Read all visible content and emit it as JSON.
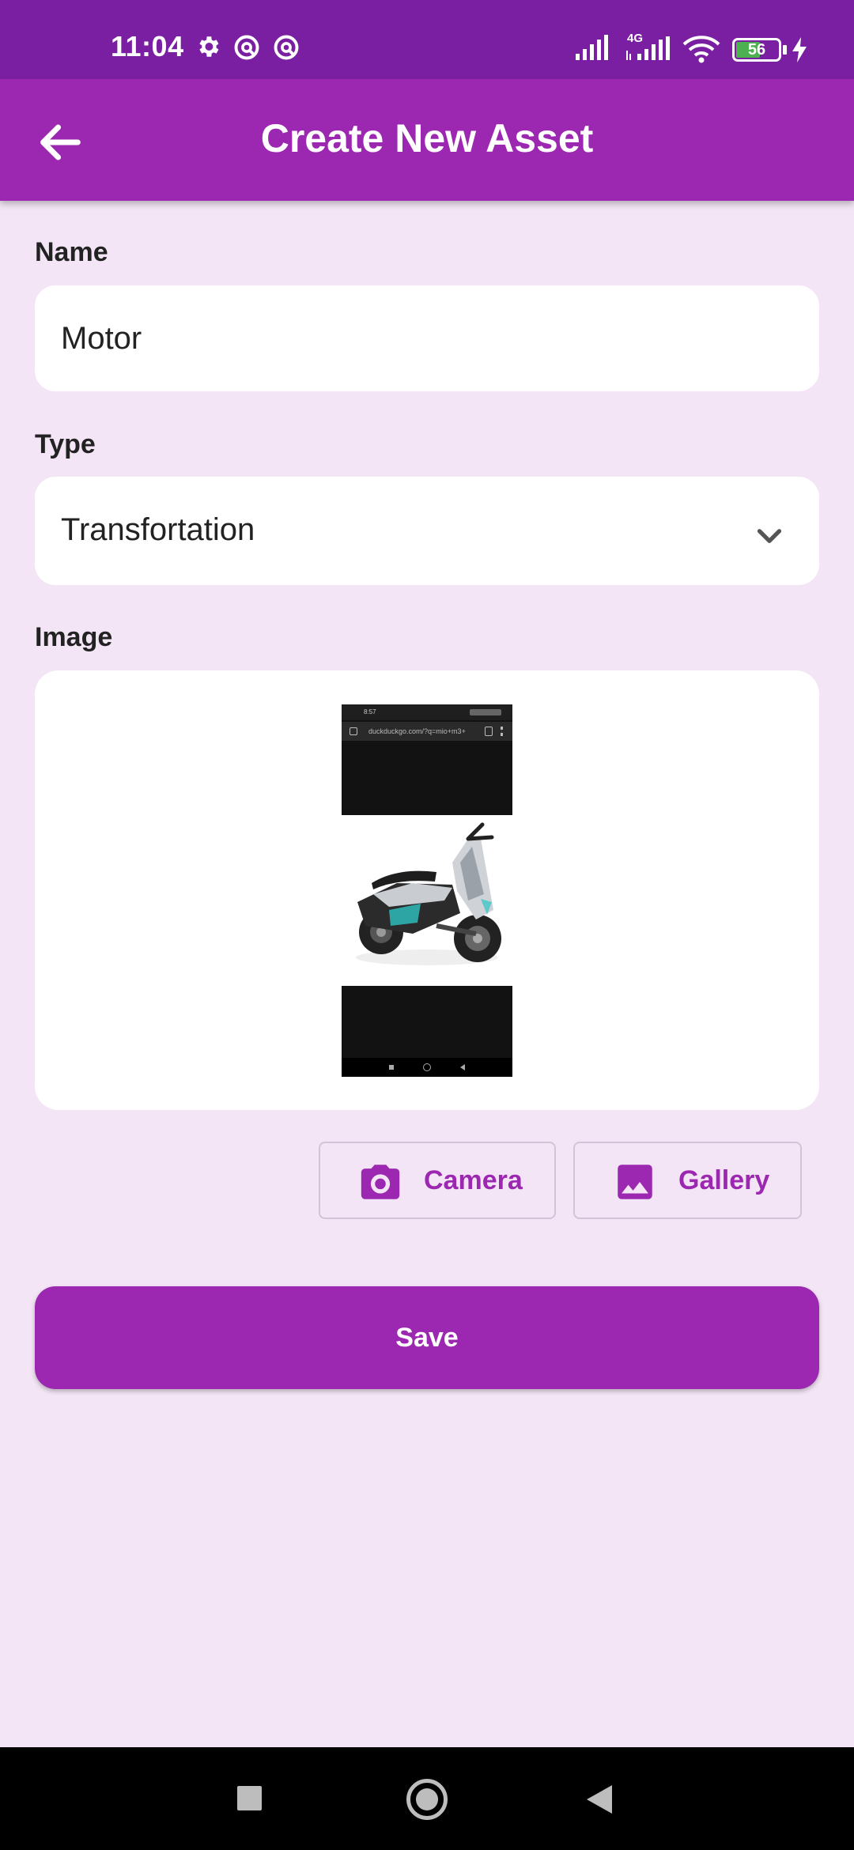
{
  "status_bar": {
    "time": "11:04",
    "network": "4G",
    "battery": "56"
  },
  "app_bar": {
    "title": "Create New Asset",
    "back_icon": "arrow-back-icon"
  },
  "form": {
    "name": {
      "label": "Name",
      "value": "Motor"
    },
    "type": {
      "label": "Type",
      "value": "Transfortation",
      "icon": "chevron-down-icon"
    },
    "image": {
      "label": "Image",
      "preview_url_text": "duckduckgo.com/?q=mio+m3+",
      "preview_time": "8:57"
    }
  },
  "buttons": {
    "camera": {
      "label": "Camera",
      "icon": "camera-icon"
    },
    "gallery": {
      "label": "Gallery",
      "icon": "image-icon"
    },
    "save": {
      "label": "Save"
    }
  },
  "colors": {
    "status_bar": "#7b1fa2",
    "primary": "#9c27b0",
    "background": "#f3e5f5"
  }
}
